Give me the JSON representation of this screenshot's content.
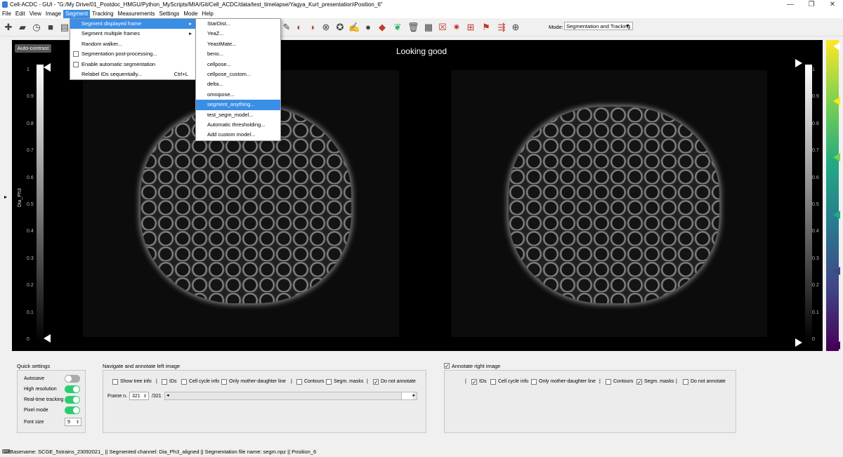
{
  "window": {
    "title": "Cell-ACDC - GUI - \"G:/My Drive/01_Postdoc_HMGU/Python_MyScripts/MIA/Git/Cell_ACDC/data/test_timelapse/Yagya_Kurt_presentation\\Position_6\"",
    "min": "—",
    "max": "❐",
    "close": "✕"
  },
  "menubar": {
    "items": [
      "File",
      "Edit",
      "View",
      "Image",
      "Segment",
      "Tracking",
      "Measurements",
      "Settings",
      "Mode",
      "Help"
    ]
  },
  "toolbar": {
    "mode_label": "Mode:",
    "mode_value": "Segmentation and Tracking"
  },
  "viewer": {
    "title": "Looking good",
    "autocontrast": "Auto-contrast",
    "ylabel": "Dia_Ph3",
    "ticks_left": [
      "1",
      "0.9",
      "0.8",
      "0.7",
      "0.6",
      "0.5",
      "0.4",
      "0.3",
      "0.2",
      "0.1",
      "0"
    ],
    "ticks_right": [
      "1",
      "0.9",
      "0.8",
      "0.7",
      "0.6",
      "0.5",
      "0.4",
      "0.3",
      "0.2",
      "0.1",
      "0"
    ]
  },
  "segment_menu": {
    "items": [
      {
        "label": "Segment displayed frame",
        "arrow": "▸"
      },
      {
        "label": "Segment multiple frames",
        "arrow": "▸"
      },
      {
        "label": "Random walker..."
      },
      {
        "label": "Segmentation post-processing..."
      },
      {
        "label": "Enable automatic segmentation"
      },
      {
        "label": "Relabel IDs sequentially...",
        "shortcut": "Ctrl+L"
      }
    ]
  },
  "model_menu": {
    "items": [
      "StarDist...",
      "YeaZ...",
      "YeastMate...",
      "beno...",
      "cellpose...",
      "cellpose_custom...",
      "delta...",
      "omnipose...",
      "segment_anything...",
      "test_segm_model...",
      "Automatic thresholding...",
      "Add custom model..."
    ]
  },
  "quick_settings": {
    "title": "Quick settings",
    "autosave": "Autosave",
    "high_res": "High resolution",
    "rt_tracking": "Real-time tracking",
    "pixel_mode": "Pixel mode",
    "font_size": "Font size",
    "font_size_value": "9"
  },
  "left_nav": {
    "title": "Navigate and annotate left image",
    "show_tree": "Show tree info",
    "ids": "IDs",
    "cell_cycle": "Cell cycle info",
    "mother_daughter": "Only mother-daughter line",
    "contours": "Contours",
    "segm_masks": "Segm. masks",
    "do_not_annotate": "Do not annotate",
    "frame_label": "Frame n.",
    "frame_value": "321",
    "frame_total": "/321"
  },
  "right_nav": {
    "title": "Annotate right image",
    "ids": "IDs",
    "cell_cycle": "Cell cycle info",
    "mother_daughter": "Only mother-daughter line",
    "contours": "Contours",
    "segm_masks": "Segm. masks",
    "do_not_annotate": "Do not annotate"
  },
  "statusbar": {
    "text": "Basename: SCGE_5strains_23092021_ || Segmented channel: Dia_Ph3_aligned || Segmentation file name: segm.npz || Position_6"
  },
  "colors": {
    "accent": "#3a8ee6",
    "toggle_on": "#2ecc71"
  }
}
